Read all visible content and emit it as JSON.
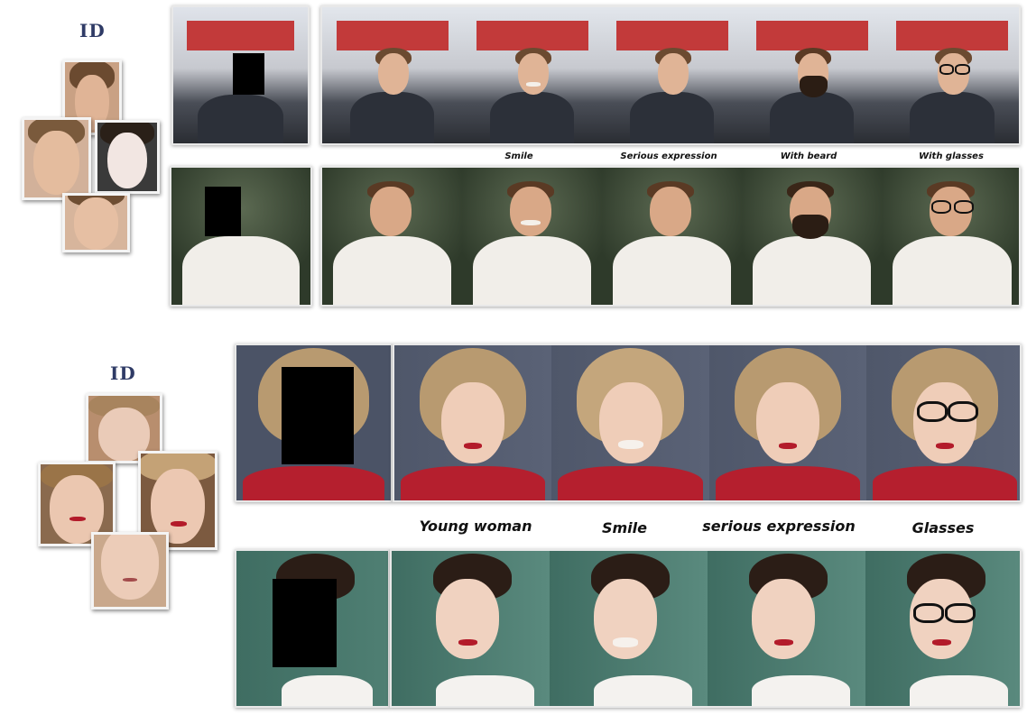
{
  "id_label_top": "ID",
  "id_label_bottom": "ID",
  "captions_top": [
    "Smile",
    "Serious expression",
    "With beard",
    "With glasses"
  ],
  "captions_bottom": [
    "Young woman",
    "Smile",
    "serious expression",
    "Glasses"
  ],
  "colors": {
    "id_text": "#2f3b66",
    "shirt_dark": "#2c3039",
    "shirt_white": "#f1eee9",
    "top_red": "#b51f2e",
    "bg_teal": "#4f7f73",
    "bg_slate": "#4b5366",
    "skin": "#e4b69a",
    "hair_brown": "#5a3a24",
    "hair_blonde": "#b89a70",
    "hair_dark": "#2b1d16"
  }
}
